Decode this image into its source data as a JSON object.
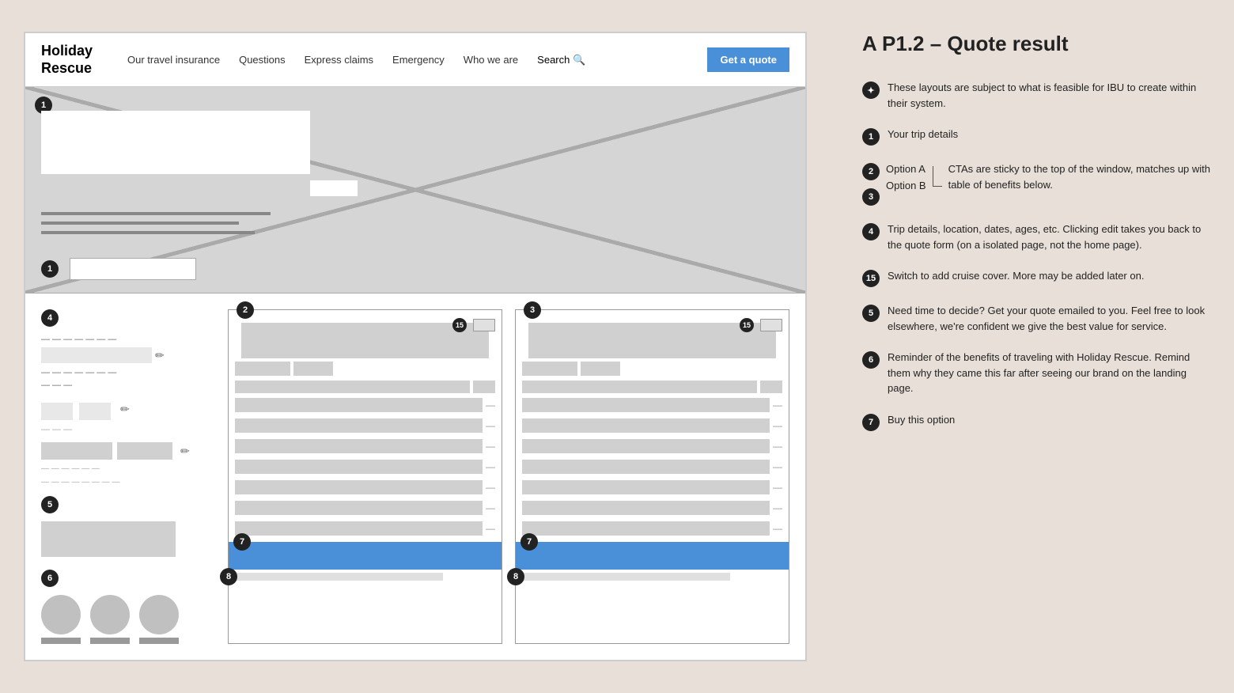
{
  "page": {
    "title": "A P1.2 – Quote result"
  },
  "nav": {
    "logo_line1": "Holiday",
    "logo_line2": "Rescue",
    "links": [
      "Our travel insurance",
      "Questions",
      "Express claims",
      "Emergency",
      "Who we are",
      "Search"
    ],
    "cta": "Get a quote"
  },
  "annotations": [
    {
      "badge": "✦",
      "text": "These layouts are subject to what is feasible for IBU to create within their system.",
      "id": "star"
    },
    {
      "badge": "1",
      "text": "Your trip details"
    },
    {
      "badge": "2",
      "text": "Option A",
      "grouped": true
    },
    {
      "badge": "3",
      "text": "Option B",
      "grouped": true
    },
    {
      "badge": "group-note",
      "text": "CTAs are sticky to the top of the window, matches up with table of benefits below."
    },
    {
      "badge": "4",
      "text": "Trip details, location, dates, ages, etc. Clicking edit takes you back to the quote form (on a isolated page, not the home page)."
    },
    {
      "badge": "15",
      "text": "Switch to add cruise cover. More may be added later on."
    },
    {
      "badge": "5",
      "text": "Need time to decide? Get your quote emailed to you. Feel free to look elsewhere, we're confident we give the best value for service."
    },
    {
      "badge": "6",
      "text": "Reminder of the benefits of traveling with Holiday Rescue. Remind them why they came this far after seeing our brand on the landing page."
    },
    {
      "badge": "7",
      "text": "Buy this option"
    }
  ]
}
